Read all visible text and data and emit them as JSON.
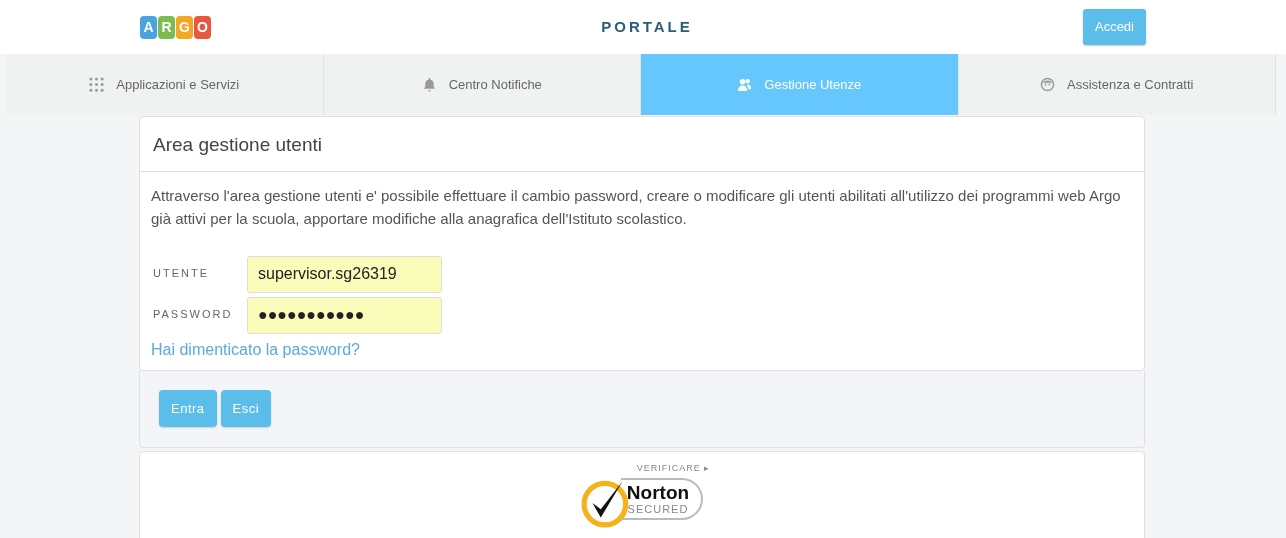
{
  "header": {
    "logo": [
      {
        "letter": "A",
        "color": "#4aa3df"
      },
      {
        "letter": "R",
        "color": "#7dbb4f"
      },
      {
        "letter": "G",
        "color": "#f5a623"
      },
      {
        "letter": "O",
        "color": "#e9573f"
      }
    ],
    "title": "PORTALE",
    "login_button": "Accedi"
  },
  "tabs": [
    {
      "label": "Applicazioni e Servizi",
      "kind": "grid",
      "selected": false
    },
    {
      "label": "Centro Notifiche",
      "kind": "bell",
      "selected": false
    },
    {
      "label": "Gestione Utenze",
      "kind": "users",
      "selected": true
    },
    {
      "label": "Assistenza e Contratti",
      "kind": "face",
      "selected": false
    }
  ],
  "panel": {
    "title": "Area gestione utenti",
    "description": "Attraverso l'area gestione utenti e' possibile effettuare il cambio password, creare o modificare gli utenti abilitati all'utilizzo dei programmi web Argo già attivi per la scuola, apportare modifiche alla anagrafica dell'Istituto scolastico.",
    "fields": [
      {
        "label": "UTENTE",
        "value": "supervisor.sg26319"
      },
      {
        "label": "PASSWORD",
        "value": "●●●●●●●●●●●"
      }
    ],
    "forgot_link": "Hai dimenticato la password?",
    "buttons": [
      "Entra",
      "Esci"
    ]
  },
  "seal": {
    "top": "VERIFICARE ▸",
    "brand": "Norton",
    "sub": "SECURED"
  }
}
